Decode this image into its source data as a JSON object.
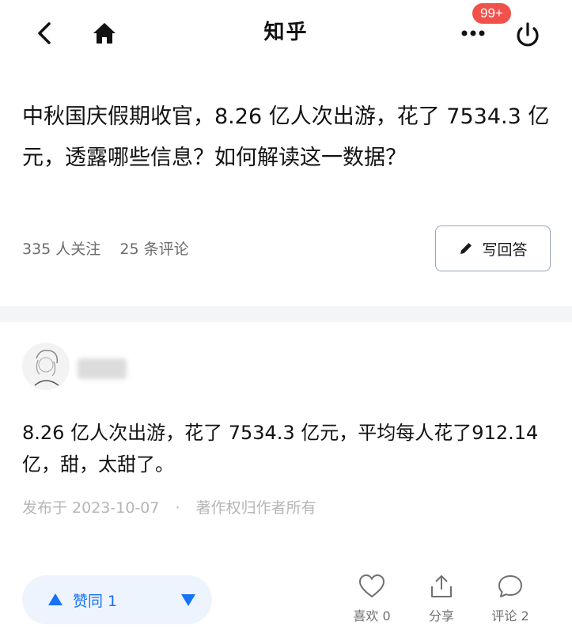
{
  "app": {
    "title": "知乎",
    "badge": "99+",
    "accent_color": "#1772f6",
    "badge_color": "#f0524b"
  },
  "question": {
    "title": "中秋国庆假期收官，8.26 亿人次出游，花了 7534.3 亿元，透露哪些信息？如何解读这一数据？",
    "followers": "335 人关注",
    "comments": "25 条评论",
    "write_answer_label": "写回答"
  },
  "answer": {
    "content": "8.26 亿人次出游，花了 7534.3 亿元，平均每人花了912.14亿，甜，太甜了。",
    "published": "发布于 2023-10-07",
    "separator": "·",
    "copyright": "著作权归作者所有",
    "upvote_label": "赞同 1",
    "like_label": "喜欢 0",
    "share_label": "分享",
    "comment_label": "评论 2"
  },
  "icons": {
    "back": "back-arrow-icon",
    "home": "home-icon",
    "more": "more-dots-icon",
    "power": "power-icon",
    "pencil": "pencil-icon",
    "upvote": "triangle-up-icon",
    "downvote": "triangle-down-icon",
    "like": "heart-icon",
    "share": "share-icon",
    "comment": "comment-bubble-icon"
  }
}
